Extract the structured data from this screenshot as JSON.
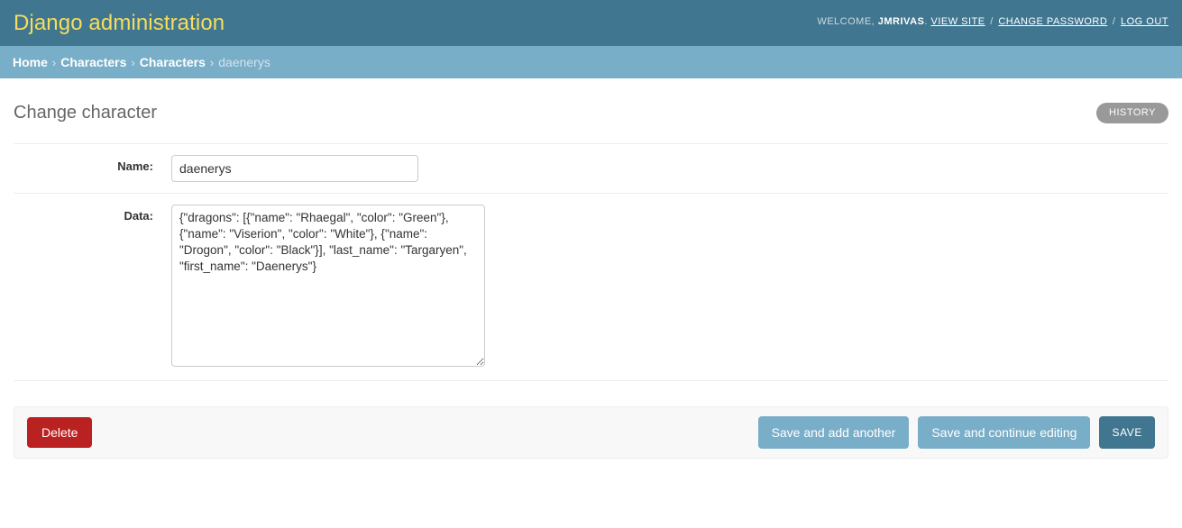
{
  "header": {
    "site_title": "Django administration",
    "user_tools": {
      "welcome_label": "WELCOME,",
      "username": "JMRIVAS",
      "period": ".",
      "view_site": "VIEW SITE",
      "separator": "/",
      "change_password": "CHANGE PASSWORD",
      "log_out": "LOG OUT"
    }
  },
  "breadcrumbs": {
    "separator": "›",
    "items": [
      {
        "label": "Home",
        "current": false
      },
      {
        "label": "Characters",
        "current": false
      },
      {
        "label": "Characters",
        "current": false
      },
      {
        "label": "daenerys",
        "current": true
      }
    ]
  },
  "content": {
    "page_title": "Change character",
    "history_button": "HISTORY"
  },
  "form": {
    "rows": [
      {
        "label": "Name:",
        "type": "text",
        "value": "daenerys",
        "placeholder": ""
      },
      {
        "label": "Data:",
        "type": "textarea",
        "value": "{\"dragons\": [{\"name\": \"Rhaegal\", \"color\": \"Green\"}, {\"name\": \"Viserion\", \"color\": \"White\"}, {\"name\": \"Drogon\", \"color\": \"Black\"}], \"last_name\": \"Targaryen\", \"first_name\": \"Daenerys\"}",
        "placeholder": ""
      }
    ]
  },
  "submit_row": {
    "delete_label": "Delete",
    "save_add_another_label": "Save and add another",
    "save_continue_label": "Save and continue editing",
    "save_label": "SAVE"
  },
  "colors": {
    "header_bg": "#417690",
    "breadcrumb_bg": "#79aec8",
    "brand_text": "#f5dd5d",
    "delete_red": "#ba2121",
    "save_blue": "#417690",
    "secondary_blue": "#79aec8",
    "history_gray": "#999999",
    "submit_row_bg": "#f8f8f8"
  }
}
